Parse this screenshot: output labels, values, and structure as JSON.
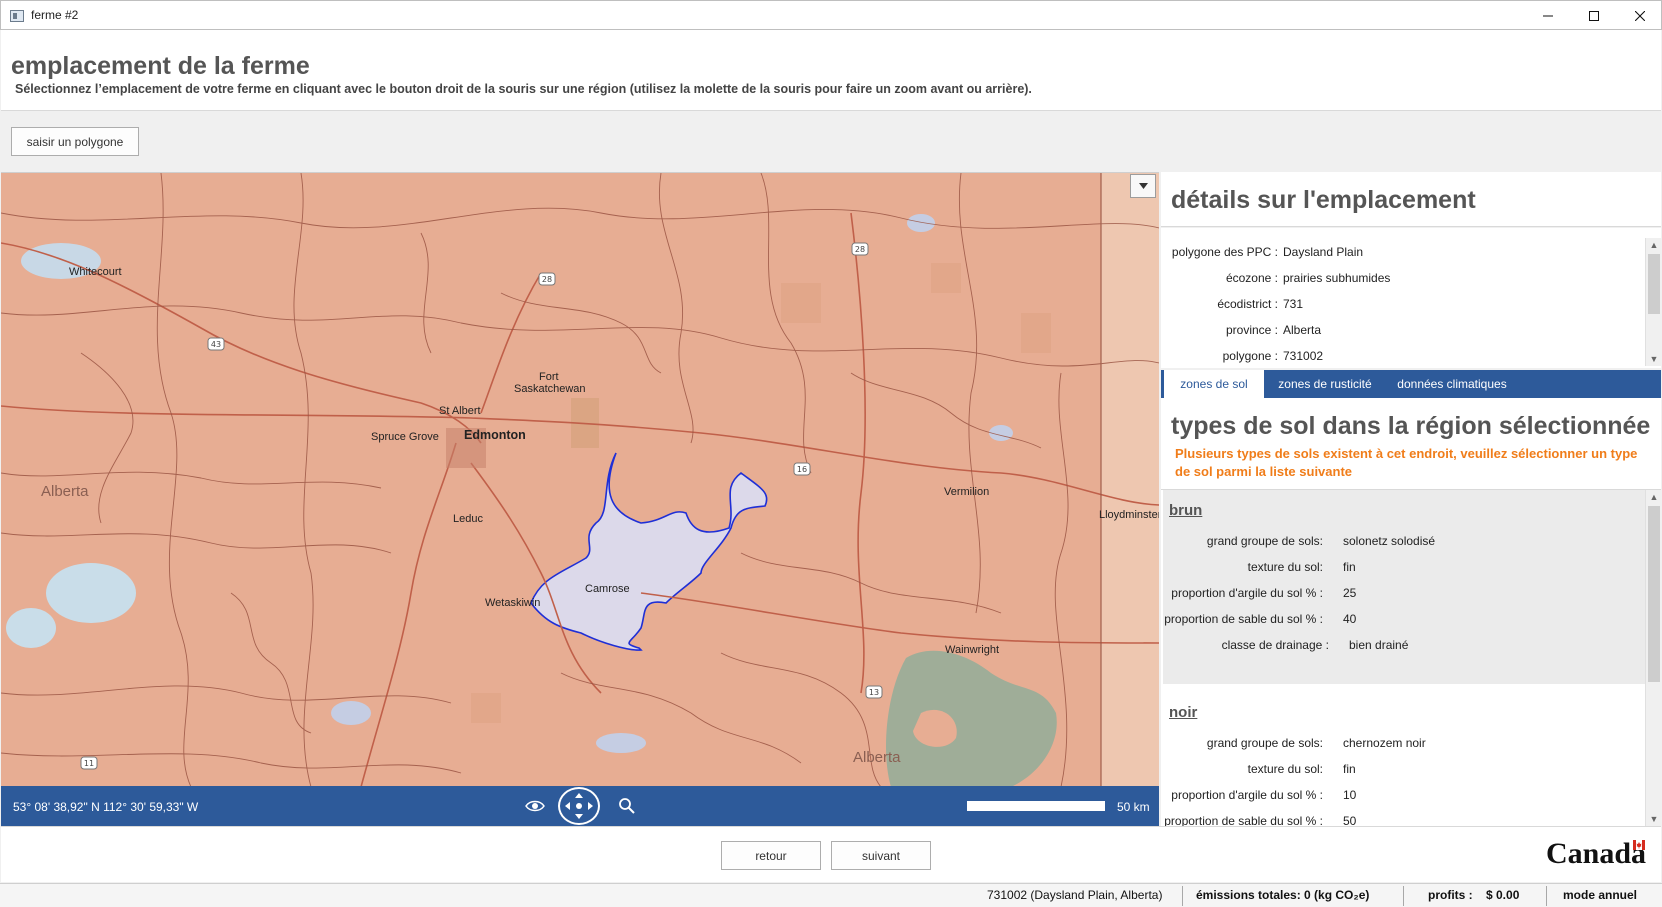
{
  "window": {
    "title": "ferme #2"
  },
  "header": {
    "title": "emplacement de la ferme",
    "instructions": "Sélectionnez l’emplacement de votre ferme en cliquant avec le bouton droit de la souris sur une région (utilisez la molette de la souris pour faire un zoom avant ou arrière)."
  },
  "toolbar": {
    "polygon_button": "saisir un polygone"
  },
  "map": {
    "labels": {
      "whitecourt": "Whitecourt",
      "fort_saskatchewan_1": "Fort",
      "fort_saskatchewan_2": "Saskatchewan",
      "st_albert": "St Albert",
      "spruce_grove": "Spruce Grove",
      "edmonton": "Edmonton",
      "alberta_west": "Alberta",
      "alberta_south": "Alberta",
      "leduc": "Leduc",
      "camrose": "Camrose",
      "wetaskiwin": "Wetaskiwin",
      "vermilion": "Vermilion",
      "lloydminster": "Lloydminster",
      "wainwright": "Wainwright"
    },
    "highways": {
      "h28a": "28",
      "h28b": "28",
      "h43": "43",
      "h16": "16",
      "h13": "13",
      "h11": "11"
    },
    "coordinates": "53° 08' 38,92\" N 112° 30' 59,33\" W",
    "scale": "50 km"
  },
  "details": {
    "title": "détails sur l'emplacement",
    "rows": [
      {
        "key": "polygone des PPC :",
        "value": "Daysland Plain"
      },
      {
        "key": "écozone :",
        "value": "prairies subhumides"
      },
      {
        "key": "écodistrict :",
        "value": "731"
      },
      {
        "key": "province :",
        "value": "Alberta"
      },
      {
        "key": "polygone :",
        "value": "731002"
      }
    ]
  },
  "tabs": {
    "soil": "zones de sol",
    "hardiness": "zones de rusticité",
    "climate": "données climatiques"
  },
  "soil": {
    "title": "types de sol dans la région sélectionnée",
    "warning": "Plusieurs types de sols existent à cet endroit, veuillez sélectionner un type de sol parmi la liste suivante",
    "types": [
      {
        "name": "brun",
        "rows": [
          {
            "key": "grand groupe de sols:",
            "value": "solonetz solodisé"
          },
          {
            "key": "texture du sol:",
            "value": "fin"
          },
          {
            "key": "proportion d'argile du sol % :",
            "value": "25"
          },
          {
            "key": "proportion de sable du sol % :",
            "value": "40"
          },
          {
            "key": "classe de drainage :",
            "value": "bien drainé"
          }
        ]
      },
      {
        "name": "noir",
        "rows": [
          {
            "key": "grand groupe de sols:",
            "value": "chernozem noir"
          },
          {
            "key": "texture du sol:",
            "value": "fin"
          },
          {
            "key": "proportion d'argile du sol % :",
            "value": "10"
          },
          {
            "key": "proportion de sable du sol % :",
            "value": "50"
          }
        ]
      }
    ]
  },
  "footer": {
    "back": "retour",
    "next": "suivant",
    "wordmark": "Canada"
  },
  "status": {
    "location": "731002 (Daysland Plain, Alberta)",
    "emissions": "émissions totales: 0 (kg CO₂e)",
    "profits_label": "profits :",
    "profits_value": "$ 0.00",
    "mode": "mode annuel"
  },
  "colors": {
    "accent": "#2d5a9a",
    "warning": "#f07d1a",
    "map_base": "#e7ad93",
    "selected_polygon": "#dcd9ea"
  }
}
